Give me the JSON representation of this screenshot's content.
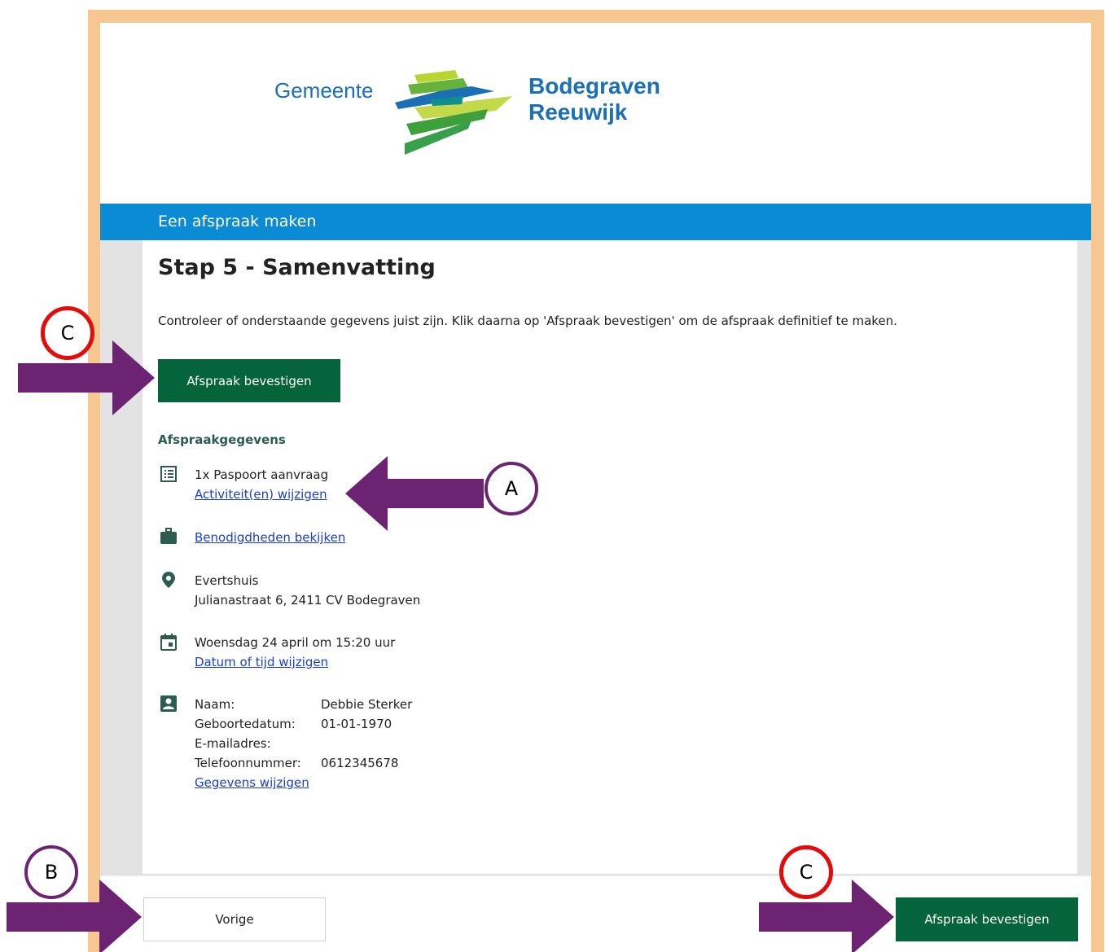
{
  "header": {
    "logo_left": "Gemeente",
    "logo_right": "Bodegraven Reeuwijk",
    "bar_title": "Een afspraak maken"
  },
  "step": {
    "title": "Stap 5 - Samenvatting",
    "intro": "Controleer of onderstaande gegevens juist zijn. Klik daarna op 'Afspraak bevestigen' om de afspraak definitief te maken.",
    "confirm_label": "Afspraak bevestigen"
  },
  "details": {
    "section_title": "Afspraakgegevens",
    "activity": "1x Paspoort aanvraag",
    "activity_link": "Activiteit(en) wijzigen",
    "requirements_link": "Benodigdheden bekijken",
    "location_name": "Evertshuis",
    "location_address": "Julianastraat 6, 2411 CV Bodegraven",
    "datetime": "Woensdag 24 april om 15:20 uur",
    "datetime_link": "Datum of tijd wijzigen",
    "personal": {
      "name_label": "Naam:",
      "name_value": "Debbie Sterker",
      "dob_label": "Geboortedatum:",
      "dob_value": "01-01-1970",
      "email_label": "E-mailadres:",
      "email_value": "",
      "phone_label": "Telefoonnummer:",
      "phone_value": "0612345678",
      "edit_link": "Gegevens wijzigen"
    }
  },
  "footer": {
    "prev_label": "Vorige",
    "confirm_label": "Afspraak bevestigen"
  },
  "annotations": {
    "a": "A",
    "b": "B",
    "c": "C"
  },
  "colors": {
    "frame": "#f6c791",
    "brand_blue": "#0a8bd4",
    "button_green": "#06643a",
    "annotation_red": "#e60b0b",
    "annotation_purple": "#6b2372"
  }
}
